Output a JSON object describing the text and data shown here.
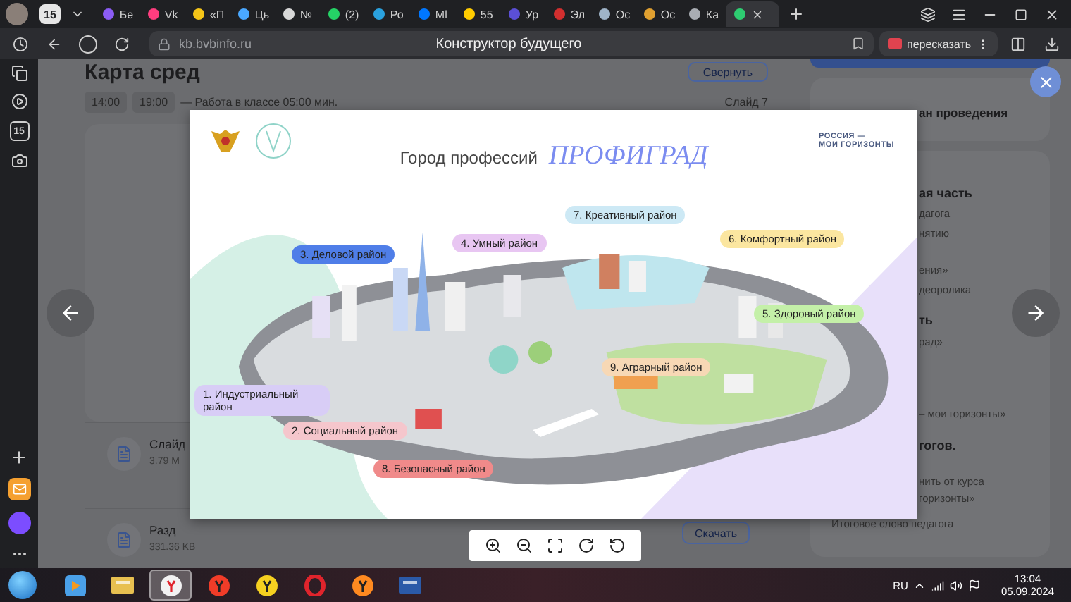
{
  "tab_bar": {
    "counter": "15",
    "tabs": [
      {
        "label": "Бе",
        "color": "#8b5cf6",
        "selected": false
      },
      {
        "label": "Vk",
        "color": "#ff3d7f",
        "selected": false
      },
      {
        "label": "«П",
        "color": "#f5c518",
        "selected": false
      },
      {
        "label": "Ць",
        "color": "#4aa8ff",
        "selected": false
      },
      {
        "label": "№",
        "color": "#d8d8d8",
        "selected": false
      },
      {
        "label": "(2)",
        "color": "#25d366",
        "selected": false
      },
      {
        "label": "Ро",
        "color": "#2aa1de",
        "selected": false
      },
      {
        "label": "Ml",
        "color": "#0077ff",
        "selected": false
      },
      {
        "label": "55",
        "color": "#ffcc00",
        "selected": false
      },
      {
        "label": "Ур",
        "color": "#5b4fd6",
        "selected": false
      },
      {
        "label": "Эл",
        "color": "#d32f2f",
        "selected": false
      },
      {
        "label": "Ос",
        "color": "#9fb4c8",
        "selected": false
      },
      {
        "label": "Ос",
        "color": "#e0a030",
        "selected": false
      },
      {
        "label": "Ка",
        "color": "#a9adb3",
        "selected": false
      },
      {
        "color": "#2ecc71",
        "selected": true
      }
    ]
  },
  "address_bar": {
    "url": "kb.bvbinfo.ru",
    "title": "Конструктор будущего",
    "action": "пересказать"
  },
  "sidebar": {
    "counter": "15"
  },
  "page": {
    "heading": "Карта сред",
    "collapse_button": "Свернуть",
    "schedule": {
      "times": [
        "14:00",
        "19:00"
      ],
      "activity": "— Работа в классе 05:00 мин.",
      "slide": "Слайд 7"
    },
    "files": [
      {
        "name": "Слайд",
        "size": "3.79 M"
      },
      {
        "name": "Разд",
        "size": "331.36 KB",
        "action": "Скачать"
      }
    ],
    "side_panel": {
      "title": "ан проведения",
      "lines": [
        {
          "kind": "heading",
          "text": "ая часть"
        },
        {
          "kind": "line",
          "text": "дагога"
        },
        {
          "kind": "line",
          "text": "нятию"
        },
        {
          "kind": "line",
          "text": "ения»"
        },
        {
          "kind": "line",
          "text": "деоролика"
        },
        {
          "kind": "heading",
          "text": "ть"
        },
        {
          "kind": "line",
          "text": "рад»"
        },
        {
          "kind": "line",
          "text": "– мои горизонты»"
        },
        {
          "kind": "heading",
          "text": "гогов."
        },
        {
          "kind": "line",
          "text": "нить от курса"
        },
        {
          "kind": "line",
          "text": "горизонты»"
        },
        {
          "kind": "note",
          "text": "Итоговое слово педагога"
        }
      ]
    }
  },
  "lightbox": {
    "slide": {
      "title": "Город профессий",
      "brand": "ПРОФИГРАД",
      "corner": [
        "РОССИЯ —",
        "МОИ ГОРИЗОНТЫ"
      ],
      "districts": [
        {
          "label": "7. Креативный район",
          "color": "#cde9f5"
        },
        {
          "label": "6. Комфортный район",
          "color": "#fbe6a0"
        },
        {
          "label": "4. Умный район",
          "color": "#e8c6f2"
        },
        {
          "label": "3. Деловой район",
          "color": "#4f7ee8"
        },
        {
          "label": "5. Здоровый район",
          "color": "#c4f0a8"
        },
        {
          "label": "9. Аграрный район",
          "color": "#f7d8b5"
        },
        {
          "label": "1. Индустриальный район",
          "color": "#d8cdf6"
        },
        {
          "label": "2. Социальный район",
          "color": "#f5c6cc"
        },
        {
          "label": "8. Безопасный район",
          "color": "#f08a8a"
        }
      ]
    }
  },
  "taskbar": {
    "apps": [
      {
        "kind": "media",
        "selected": false
      },
      {
        "kind": "explorer",
        "selected": false
      },
      {
        "kind": "browser",
        "selected": true
      },
      {
        "kind": "yandex",
        "selected": false
      },
      {
        "kind": "market",
        "selected": false
      },
      {
        "kind": "opera",
        "selected": false
      },
      {
        "kind": "firefox",
        "selected": false
      },
      {
        "kind": "word",
        "selected": false
      }
    ],
    "language": "RU",
    "time": "13:04",
    "date": "05.09.2024"
  }
}
